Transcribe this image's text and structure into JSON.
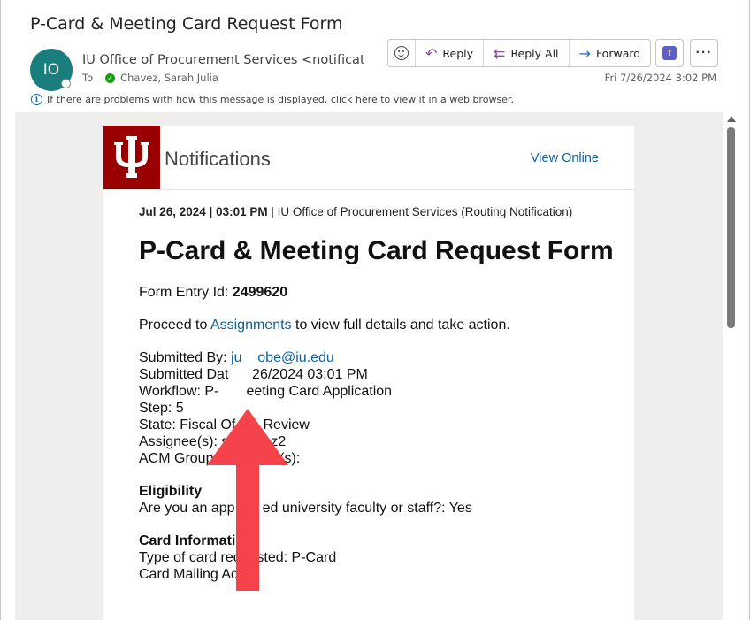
{
  "email": {
    "subject": "P-Card & Meeting Card Request Form",
    "avatar_initials": "IO",
    "sender": "IU Office of Procurement Services <notifications",
    "to_label": "To",
    "recipient": "Chavez, Sarah Julia",
    "date": "Fri 7/26/2024 3:02 PM",
    "info_text": "If there are problems with how this message is displayed, click here to view it in a web browser."
  },
  "toolbar": {
    "reply": "Reply",
    "reply_all": "Reply All",
    "forward": "Forward"
  },
  "message": {
    "header_title": "Notifications",
    "view_online": "View Online",
    "date_bold": "Jul 26, 2024 | 03:01 PM",
    "date_rest": " | IU Office of Procurement Services (Routing Notification)",
    "title": "P-Card & Meeting Card Request Form",
    "form_entry_label": "Form Entry Id: ",
    "form_entry_id": "2499620",
    "proceed_before": "Proceed to ",
    "proceed_link": "Assignments",
    "proceed_after": " to view full details and take action.",
    "submitted_by_label": "Submitted By: ",
    "submitted_by_value": "ju    obe@iu.edu",
    "submitted_date": "Submitted Dat      26/2024 03:01 PM",
    "workflow": "Workflow: P-       eeting Card Application",
    "step": "Step: 5",
    "state": "State: Fiscal Of       Review",
    "assignees": "Assignee(s): sc       ez2",
    "acm_group": "ACM Group Ass      ee(s):",
    "eligibility_heading": "Eligibility",
    "eligibility_q": "Are you an app       ed university faculty or staff?: Yes",
    "card_info_heading": "Card Information",
    "card_type": "Type of card requested: P-Card",
    "card_mailing": "Card Mailing Addr"
  },
  "colors": {
    "iu_crimson": "#990000",
    "link_blue": "#0f5f98",
    "annotation_arrow": "#f5424b"
  }
}
